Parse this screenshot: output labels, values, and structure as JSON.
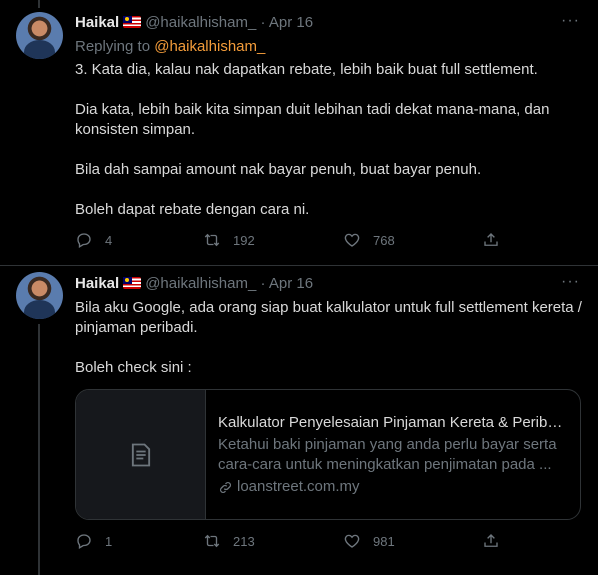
{
  "tweets": [
    {
      "name": "Haikal",
      "handle": "@haikalhisham_",
      "dot": "·",
      "date": "Apr 16",
      "more": "···",
      "replying_prefix": "Replying to",
      "replying_to": "@haikalhisham_",
      "paragraphs": [
        "3. Kata dia, kalau nak dapatkan rebate, lebih baik buat full settlement.",
        "Dia kata, lebih baik kita simpan duit lebihan tadi dekat mana-mana, dan konsisten simpan.",
        "Bila dah sampai amount nak bayar penuh, buat bayar penuh.",
        "Boleh dapat rebate dengan cara ni."
      ],
      "replies": "4",
      "retweets": "192",
      "likes": "768"
    },
    {
      "name": "Haikal",
      "handle": "@haikalhisham_",
      "dot": "·",
      "date": "Apr 16",
      "more": "···",
      "paragraphs": [
        "Bila aku Google, ada orang siap buat kalkulator untuk full settlement kereta / pinjaman peribadi.",
        "Boleh check sini :"
      ],
      "card": {
        "title": "Kalkulator Penyelesaian Pinjaman Kereta & Peribad...",
        "description": "Ketahui baki pinjaman yang anda perlu bayar serta cara-cara untuk meningkatkan penjimatan pada ...",
        "url": "loanstreet.com.my"
      },
      "replies": "1",
      "retweets": "213",
      "likes": "981"
    }
  ],
  "colors": {
    "background": "#000000",
    "text": "#d9d9d9",
    "muted": "#6e767d",
    "mention": "#f39c3a",
    "border": "#2f3336"
  },
  "icons": [
    "reply-icon",
    "retweet-icon",
    "like-icon",
    "share-icon",
    "link-icon",
    "document-icon",
    "more-icon"
  ]
}
